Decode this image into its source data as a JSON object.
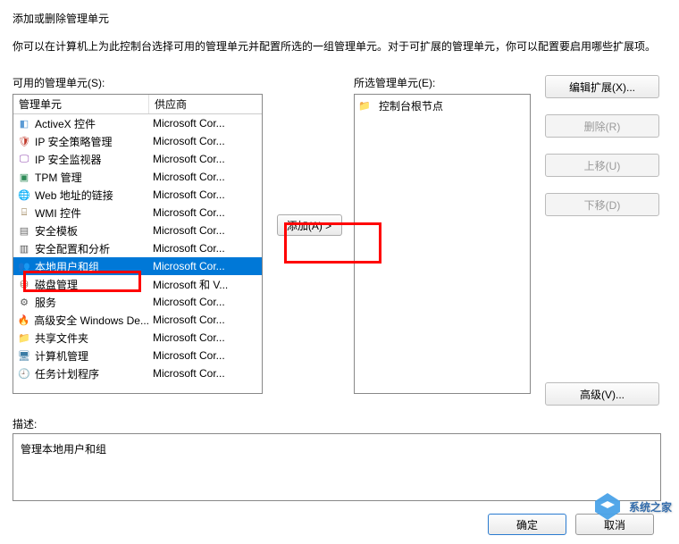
{
  "dialog": {
    "title": "添加或删除管理单元",
    "instruction": "你可以在计算机上为此控制台选择可用的管理单元并配置所选的一组管理单元。对于可扩展的管理单元，你可以配置要启用哪些扩展项。"
  },
  "available": {
    "label": "可用的管理单元(S):",
    "columns": {
      "name": "管理单元",
      "vendor": "供应商"
    },
    "items": [
      {
        "name": "ActiveX 控件",
        "vendor": "Microsoft Cor...",
        "icon": "ico-control",
        "glyph": "◧"
      },
      {
        "name": "IP 安全策略管理",
        "vendor": "Microsoft Cor...",
        "icon": "ico-shield",
        "glyph": "🛡"
      },
      {
        "name": "IP 安全监视器",
        "vendor": "Microsoft Cor...",
        "icon": "ico-monitor",
        "glyph": "🖵"
      },
      {
        "name": "TPM 管理",
        "vendor": "Microsoft Cor...",
        "icon": "ico-chip",
        "glyph": "▣"
      },
      {
        "name": "Web 地址的链接",
        "vendor": "Microsoft Cor...",
        "icon": "ico-globe",
        "glyph": "🌐"
      },
      {
        "name": "WMI 控件",
        "vendor": "Microsoft Cor...",
        "icon": "ico-cube",
        "glyph": "⌸"
      },
      {
        "name": "安全模板",
        "vendor": "Microsoft Cor...",
        "icon": "ico-template",
        "glyph": "▤"
      },
      {
        "name": "安全配置和分析",
        "vendor": "Microsoft Cor...",
        "icon": "ico-wrench",
        "glyph": "▥"
      },
      {
        "name": "本地用户和组",
        "vendor": "Microsoft Cor...",
        "icon": "ico-users",
        "glyph": "👥",
        "selected": true
      },
      {
        "name": "磁盘管理",
        "vendor": "Microsoft 和 V...",
        "icon": "ico-disk",
        "glyph": "⛁"
      },
      {
        "name": "服务",
        "vendor": "Microsoft Cor...",
        "icon": "ico-gear",
        "glyph": "⚙"
      },
      {
        "name": "高级安全 Windows De...",
        "vendor": "Microsoft Cor...",
        "icon": "ico-firewall",
        "glyph": "🔥"
      },
      {
        "name": "共享文件夹",
        "vendor": "Microsoft Cor...",
        "icon": "ico-share",
        "glyph": "📁"
      },
      {
        "name": "计算机管理",
        "vendor": "Microsoft Cor...",
        "icon": "ico-pc",
        "glyph": "🖥"
      },
      {
        "name": "任务计划程序",
        "vendor": "Microsoft Cor...",
        "icon": "ico-clock",
        "glyph": "🕘"
      }
    ]
  },
  "middle": {
    "add_label": "添加(A) >"
  },
  "selected": {
    "label": "所选管理单元(E):",
    "root": {
      "name": "控制台根节点",
      "glyph": "📁"
    }
  },
  "side_buttons": {
    "edit": "编辑扩展(X)...",
    "remove": "删除(R)",
    "up": "上移(U)",
    "down": "下移(D)",
    "advanced": "高级(V)..."
  },
  "description": {
    "label": "描述:",
    "text": "管理本地用户和组"
  },
  "bottom": {
    "ok": "确定",
    "cancel": "取消"
  },
  "watermark": "系统之家"
}
